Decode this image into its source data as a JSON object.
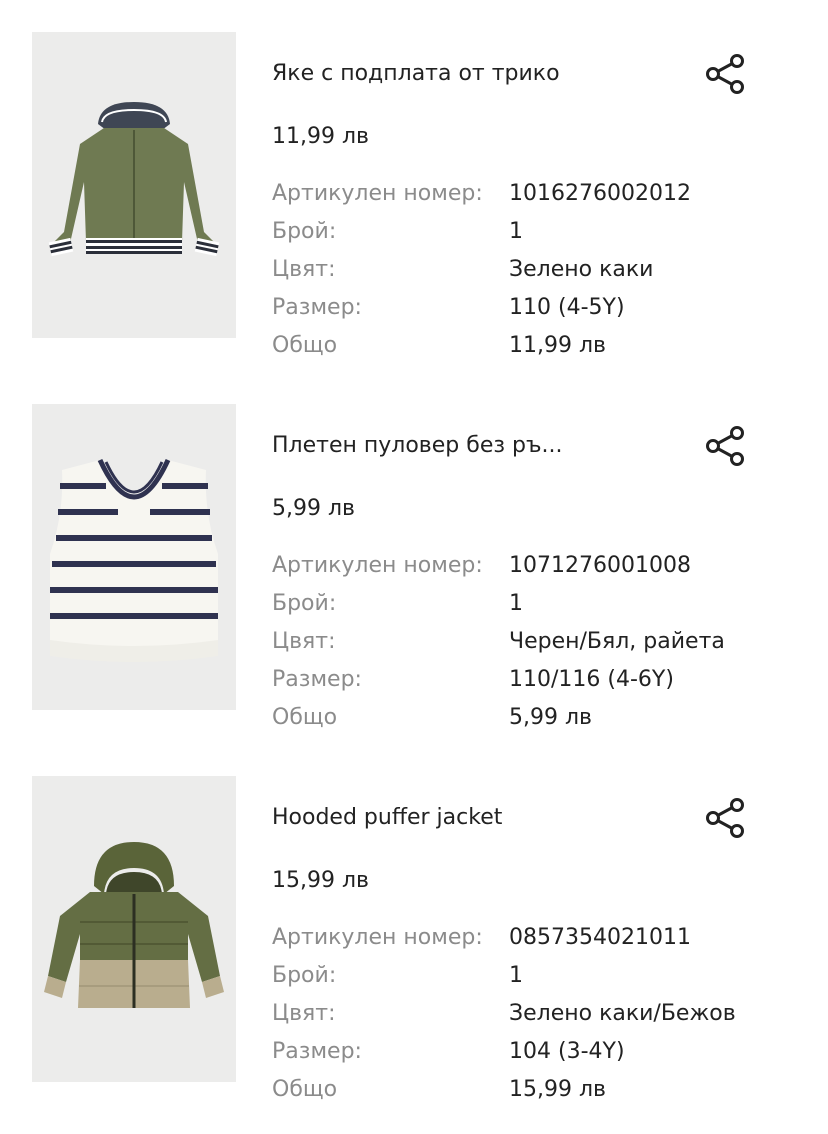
{
  "labels": {
    "article_number": "Артикулен номер:",
    "quantity": "Брой:",
    "color": "Цвят:",
    "size": "Размер:",
    "total": "Общо"
  },
  "items": [
    {
      "name": "Яке с подплата от трико",
      "price": "11,99 лв",
      "article_number": "1016276002012",
      "quantity": "1",
      "color": "Зелено каки",
      "size": "110 (4-5Y)",
      "total": "11,99 лв"
    },
    {
      "name": "Плетен пуловер без ръ...",
      "price": "5,99 лв",
      "article_number": "1071276001008",
      "quantity": "1",
      "color": "Черен/Бял, райета",
      "size": "110/116 (4-6Y)",
      "total": "5,99 лв"
    },
    {
      "name": "Hooded puffer jacket",
      "price": "15,99 лв",
      "article_number": "0857354021011",
      "quantity": "1",
      "color": "Зелено каки/Бежов",
      "size": "104 (3-4Y)",
      "total": "15,99 лв"
    }
  ],
  "icons": {
    "share": "share-icon"
  },
  "colors": {
    "text": "#222222",
    "label": "#8b8b8b",
    "image_bg": "#ececeb"
  }
}
